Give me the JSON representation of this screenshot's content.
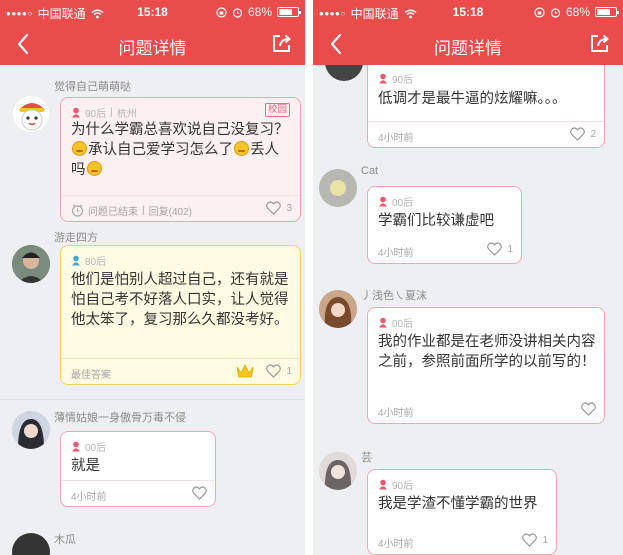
{
  "status_bar": {
    "carrier": "中国联通",
    "time": "15:18",
    "battery": "68%"
  },
  "nav": {
    "title": "问题详情"
  },
  "left": {
    "question": {
      "user": "觉得自己萌萌哒",
      "age": "90后",
      "city": "杭州",
      "tag": "校园",
      "text_a": "为什么学霸总喜欢说自己没复习？",
      "text_b": "承认自己爱学习怎么了",
      "text_c": "丢人吗",
      "status": "问题已结束",
      "replies": "回复(402)",
      "likes": "3"
    },
    "best_answer": {
      "user": "游走四方",
      "age": "80后",
      "text": "他们是怕别人超过自己，还有就是怕自己考不好落人口实，让人觉得他太笨了，复习那么久都没考好。",
      "label": "最佳答案",
      "likes": "1"
    },
    "answer": {
      "user": "薄情姑娘一身傲骨万毒不侵",
      "age": "00后",
      "text": "就是",
      "time": "4小时前"
    },
    "next_user": "木瓜"
  },
  "right": {
    "answers": [
      {
        "age": "90后",
        "text": "低调才是最牛逼的炫耀嘛。。。",
        "time": "4小时前",
        "likes": "2"
      },
      {
        "user": "Cat",
        "age": "00后",
        "text": "学霸们比较谦虚吧",
        "time": "4小时前",
        "likes": "1"
      },
      {
        "user": "丿浅色㇏夏沫",
        "age": "00后",
        "text": "我的作业都是在老师没讲相关内容之前，参照前面所学的以前写的！",
        "time": "4小时前"
      },
      {
        "user": "芸",
        "age": "90后",
        "text": "我是学渣不懂学霸的世界",
        "time": "4小时前",
        "likes": "1"
      }
    ]
  },
  "colors": {
    "brand_red": "#ea4b4b",
    "bubble_border": "#f2a5b5",
    "best_border": "#f5d35a"
  }
}
